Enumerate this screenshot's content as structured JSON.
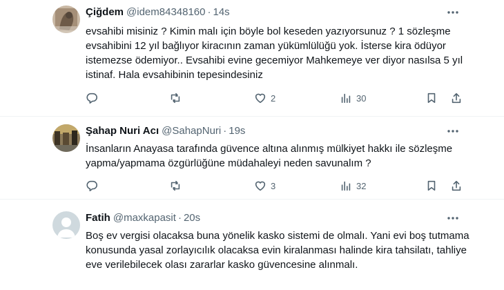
{
  "colors": {
    "text": "#0f1419",
    "secondary": "#536471",
    "divider": "#eff3f4",
    "avatar_default_bg": "#cfd9de"
  },
  "separator": "·",
  "tweets": [
    {
      "name": "Çiğdem",
      "handle": "@idem84348160",
      "time": "14s",
      "text": "evsahibi misiniz ? Kimin malı için böyle bol keseden yazıyorsunuz ? 1 sözleşme evsahibini 12 yıl bağlıyor kiracının zaman yükümlülüğü yok. İsterse kira ödüyor istemezse ödemiyor.. Evsahibi evine gecemiyor Mahkemeye ver diyor nasılsa 5 yıl istinaf. Hala evsahibinin tepesindesiniz",
      "reply_count": "",
      "retweet_count": "",
      "like_count": "2",
      "view_count": "30",
      "avatar_icon": "photo-avatar"
    },
    {
      "name": "Şahap Nuri Acı",
      "handle": "@SahapNuri",
      "time": "19s",
      "text": "İnsanların Anayasa tarafında güvence altına alınmış mülkiyet hakkı ile sözleşme yapma/yapmama özgürlüğüne müdahaleyi neden savunalım ?",
      "reply_count": "",
      "retweet_count": "",
      "like_count": "3",
      "view_count": "32",
      "avatar_icon": "photo-avatar"
    },
    {
      "name": "Fatih",
      "handle": "@maxkapasit",
      "time": "20s",
      "text": "Boş ev vergisi olacaksa buna yönelik kasko sistemi de olmalı. Yani evi boş tutmama konusunda yasal zorlayıcılık olacaksa evin kiralanması halinde kira tahsilatı, tahliye eve verilebilecek olası zararlar kasko güvencesine alınmalı.",
      "avatar_icon": "default-person-avatar"
    }
  ]
}
